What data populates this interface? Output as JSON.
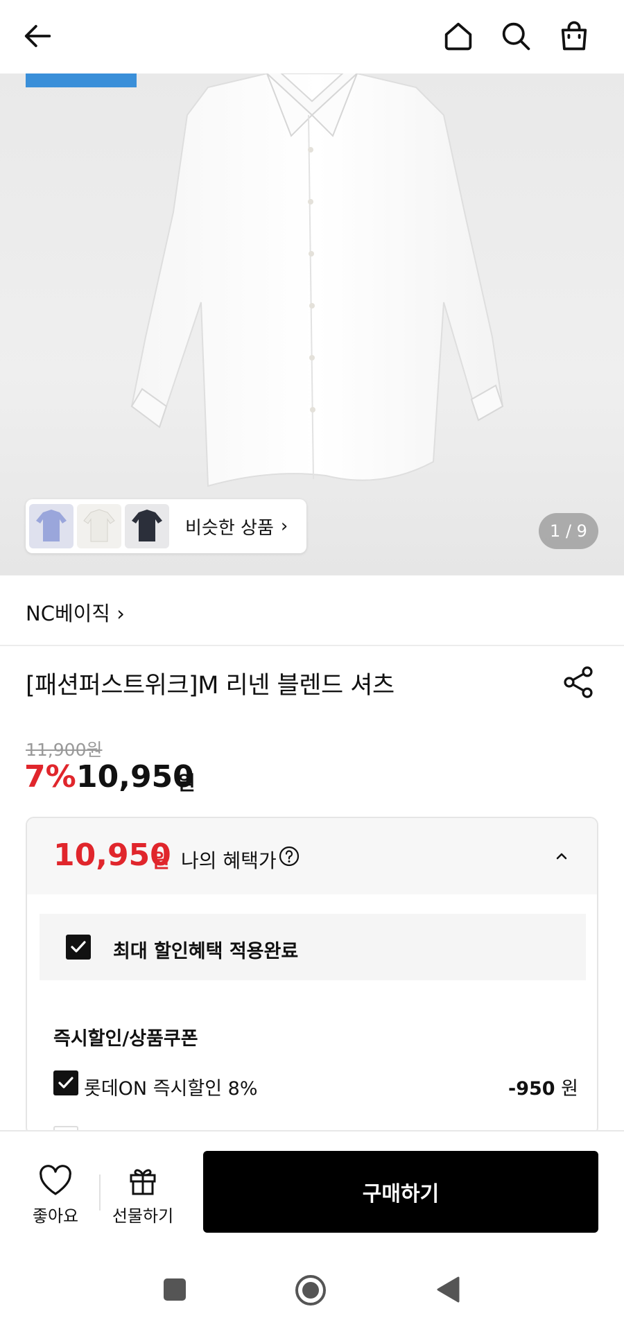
{
  "header": {
    "back_icon": "arrow-left-icon",
    "home_icon": "home-icon",
    "search_icon": "search-icon",
    "cart_icon": "shopping-bag-icon"
  },
  "gallery": {
    "similar_label": "비슷한 상품",
    "similar_thumb_colors": [
      "#9aa6db",
      "#ecebe6",
      "#2b2f3a"
    ],
    "pager": "1 / 9"
  },
  "product": {
    "brand": "NC베이직 ›",
    "title": "[패션퍼스트위크]M 리넨 블렌드 셔츠",
    "original_price": "11,900원",
    "discount_rate": "7%",
    "price": "10,950",
    "price_unit": "원"
  },
  "benefit": {
    "price": "10,950",
    "price_unit": "원",
    "label": "나의 혜택가",
    "max_discount_text": "최대 할인혜택 적용완료",
    "section_title": "즉시할인/상품쿠폰",
    "coupon_label": "롯데ON 즉시할인 8%",
    "coupon_amount": "-950",
    "coupon_unit": " 원"
  },
  "actions": {
    "like_label": "좋아요",
    "gift_label": "선물하기",
    "buy_label": "구매하기"
  },
  "colors": {
    "accent_red": "#e0262c",
    "buy_button": "#000000",
    "tag_blue": "#3a8fd9"
  }
}
